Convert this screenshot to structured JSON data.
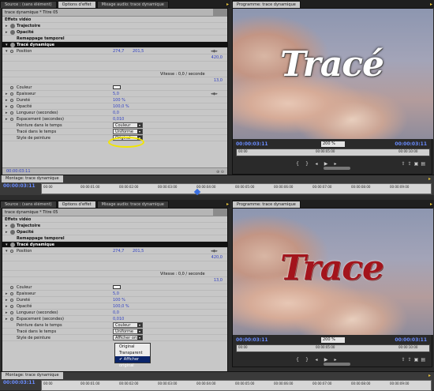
{
  "tabs_left": [
    "Source : (sans élément)",
    "Options d'effet",
    "Mixage audio: trace dynamique"
  ],
  "tab_program": "Programme: trace dynamique",
  "effects": {
    "clip_header": "trace dynamique * Titre 05",
    "section_label": "Effets vidéo",
    "items": {
      "trajectoire": "Trajectoire",
      "opacite": "Opacité",
      "remappage": "Remappage temporel",
      "trace": "Tracé dynamique",
      "position": "Position",
      "pos_x": "274,7",
      "pos_y": "201,5",
      "right_val1": "420,0",
      "vitesse": "Vitesse : 0,0 / seconde",
      "right_val2": "13,0",
      "couleur": "Couleur",
      "epaisseur": "Epaisseur",
      "epaisseur_val": "5,0",
      "durete": "Dureté",
      "durete_val": "100 %",
      "opacite2": "Opacité",
      "opacite2_val": "100,0 %",
      "longueur": "Longueur (secondes)",
      "longueur_val": "0,0",
      "espacement": "Espacement (secondes)",
      "espacement_val": "0,010",
      "peinture": "Peinture dans le temps",
      "peinture_val": "Couleur",
      "trace_temps": "Tracé dans le temps",
      "trace_temps_val": "Uniforme",
      "style": "Style de peinture",
      "style_val_top": "Original",
      "style_val_bottom": "Afficher ori..."
    },
    "footer_tc": "00:00:03:11"
  },
  "popup_options": [
    "Original",
    "Transparent",
    "Afficher original"
  ],
  "program": {
    "timecode": "00:00:03:11",
    "zoom": "200 %",
    "duration": "00:00:03:11",
    "ruler_labels": [
      "00:00",
      "00:00:05:00",
      "00:00:10:00"
    ],
    "overlay_text_top": "Tracé",
    "overlay_text_bottom": "Trace"
  },
  "timeline": {
    "tab": "Montage: trace dynamique",
    "timecode": "00:00:03:11",
    "ticks": [
      "00:00",
      "00:00:01:00",
      "00:00:02:00",
      "00:00:03:00",
      "00:00:04:00",
      "00:00:05:00",
      "00:00:06:00",
      "00:00:07:00",
      "00:00:08:00",
      "00:00:09:00"
    ]
  },
  "colors": {
    "accent_blue": "#2f3fc2",
    "timecode_blue": "#6a8cff",
    "highlight_yellow": "#f2e600",
    "menu_select": "#0a246a",
    "red_text": "#a3141c"
  }
}
